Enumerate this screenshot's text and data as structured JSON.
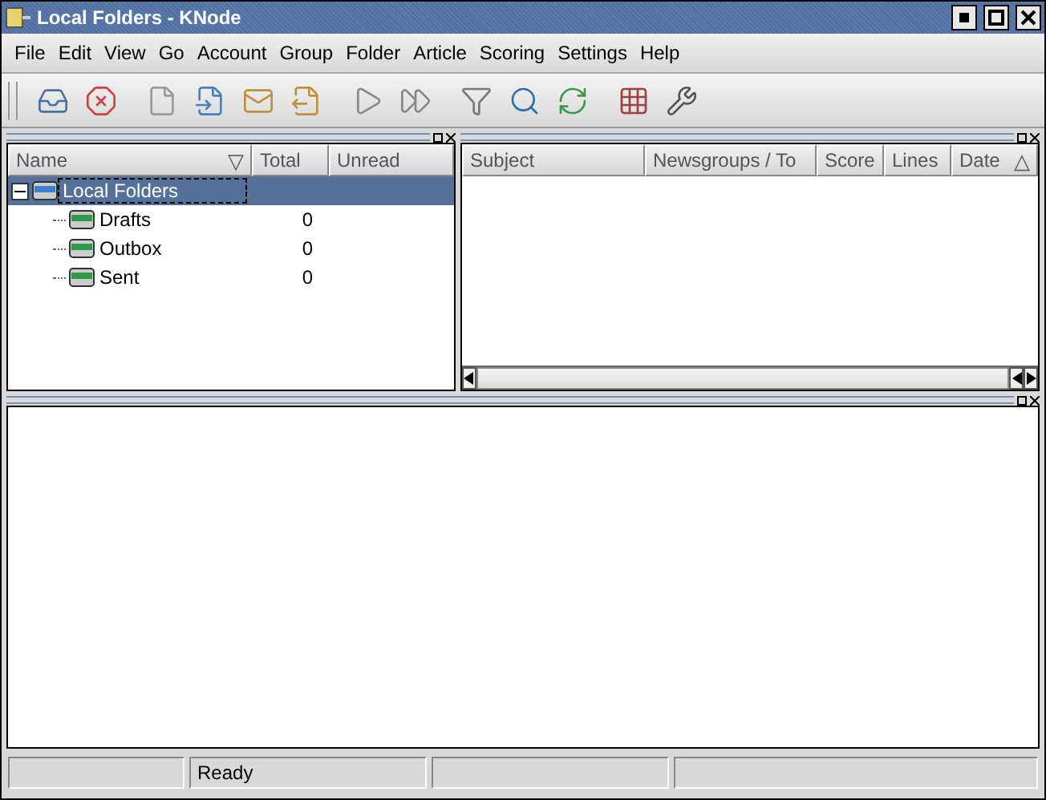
{
  "window": {
    "title": "Local Folders - KNode"
  },
  "menu": [
    "File",
    "Edit",
    "View",
    "Go",
    "Account",
    "Group",
    "Folder",
    "Article",
    "Scoring",
    "Settings",
    "Help"
  ],
  "folders": {
    "columns": [
      {
        "label": "Name",
        "sort_indicator": "▽"
      },
      {
        "label": "Total"
      },
      {
        "label": "Unread"
      }
    ],
    "tree": [
      {
        "name": "Local Folders",
        "selected": true,
        "expanded": true,
        "children": [
          {
            "name": "Drafts",
            "total": "0",
            "selected": false
          },
          {
            "name": "Outbox",
            "total": "0",
            "selected": false
          },
          {
            "name": "Sent",
            "total": "0",
            "selected": false
          }
        ]
      }
    ]
  },
  "articles": {
    "columns": [
      {
        "label": "Subject"
      },
      {
        "label": "Newsgroups / To"
      },
      {
        "label": "Score"
      },
      {
        "label": "Lines"
      },
      {
        "label": "Date",
        "sort_indicator": "△"
      }
    ]
  },
  "status_bar": {
    "message": "Ready"
  }
}
